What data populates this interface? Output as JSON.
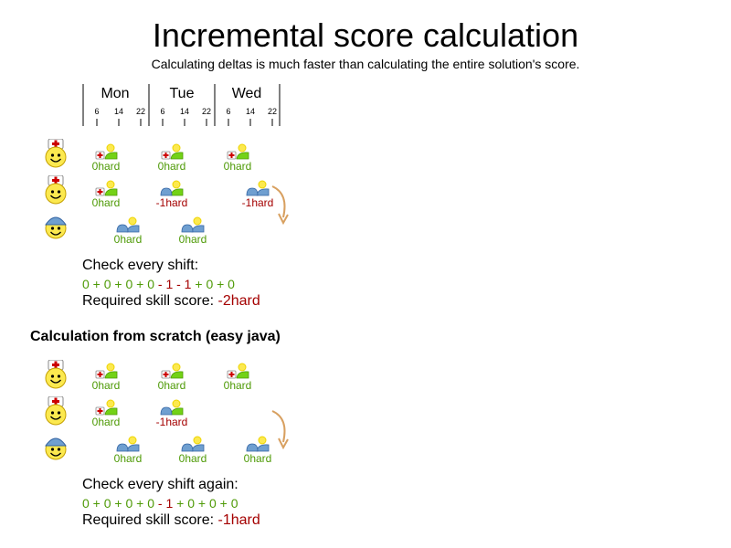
{
  "title": "Incremental score calculation",
  "subtitle": "Calculating deltas is much faster than calculating the entire solution's score.",
  "timeline": {
    "days": [
      "Mon",
      "Tue",
      "Wed"
    ],
    "hours": [
      "6",
      "14",
      "22"
    ]
  },
  "section_title": "Calculation from scratch (easy java)",
  "incremental": {
    "check_label": "Check every shift:",
    "formula_parts": [
      {
        "text": "0 + 0 + 0 + 0 ",
        "color": "#4e9a06"
      },
      {
        "text": "- 1 - 1",
        "color": "#a40000"
      },
      {
        "text": " + 0 + 0",
        "color": "#4e9a06"
      }
    ],
    "required_label": "Required skill score: ",
    "required_value": "-2hard",
    "rows": [
      {
        "employee": "nurse",
        "shifts": [
          {
            "type": "nurse",
            "score": "0hard",
            "status": "ok"
          },
          {
            "type": "nurse",
            "score": "0hard",
            "status": "ok"
          },
          {
            "type": "nurse",
            "score": "0hard",
            "status": "ok"
          }
        ]
      },
      {
        "employee": "nurse",
        "shifts": [
          {
            "type": "nurse",
            "score": "0hard",
            "status": "ok"
          },
          {
            "type": "worker",
            "score": "-1hard",
            "status": "bad"
          },
          {
            "type": "worker",
            "score": "-1hard",
            "status": "bad"
          }
        ]
      },
      {
        "employee": "worker",
        "shifts": [
          {
            "type": "worker",
            "score": "0hard",
            "status": "ok"
          },
          {
            "type": "worker",
            "score": "0hard",
            "status": "ok"
          }
        ]
      }
    ]
  },
  "scratch": {
    "check_label": "Check every shift again:",
    "formula_parts": [
      {
        "text": "0 + 0 + 0 + 0 ",
        "color": "#4e9a06"
      },
      {
        "text": "- 1",
        "color": "#a40000"
      },
      {
        "text": " + 0 + 0 + 0",
        "color": "#4e9a06"
      }
    ],
    "required_label": "Required skill score: ",
    "required_value": "-1hard",
    "rows": [
      {
        "employee": "nurse",
        "shifts": [
          {
            "type": "nurse",
            "score": "0hard",
            "status": "ok"
          },
          {
            "type": "nurse",
            "score": "0hard",
            "status": "ok"
          },
          {
            "type": "nurse",
            "score": "0hard",
            "status": "ok"
          }
        ]
      },
      {
        "employee": "nurse",
        "shifts": [
          {
            "type": "nurse",
            "score": "0hard",
            "status": "ok"
          },
          {
            "type": "worker",
            "score": "-1hard",
            "status": "bad"
          }
        ]
      },
      {
        "employee": "worker",
        "shifts": [
          {
            "type": "worker",
            "score": "0hard",
            "status": "ok"
          },
          {
            "type": "worker",
            "score": "0hard",
            "status": "ok"
          },
          {
            "type": "worker",
            "score": "0hard",
            "status": "ok"
          }
        ]
      }
    ]
  },
  "colors": {
    "ok": "#4e9a06",
    "bad": "#a40000",
    "arrow": "#d8a060",
    "shift_green": "#73d216",
    "worker_blue": "#6f9fd0",
    "sun": "#fce94f",
    "smiley": "#fce94f"
  },
  "icons": {
    "employee_nurse": "nurse-smiley-icon",
    "employee_worker": "worker-smiley-icon",
    "shift_nurse": "nurse-shift-icon",
    "shift_worker": "worker-shift-icon",
    "move_arrow": "curved-arrow-icon"
  }
}
